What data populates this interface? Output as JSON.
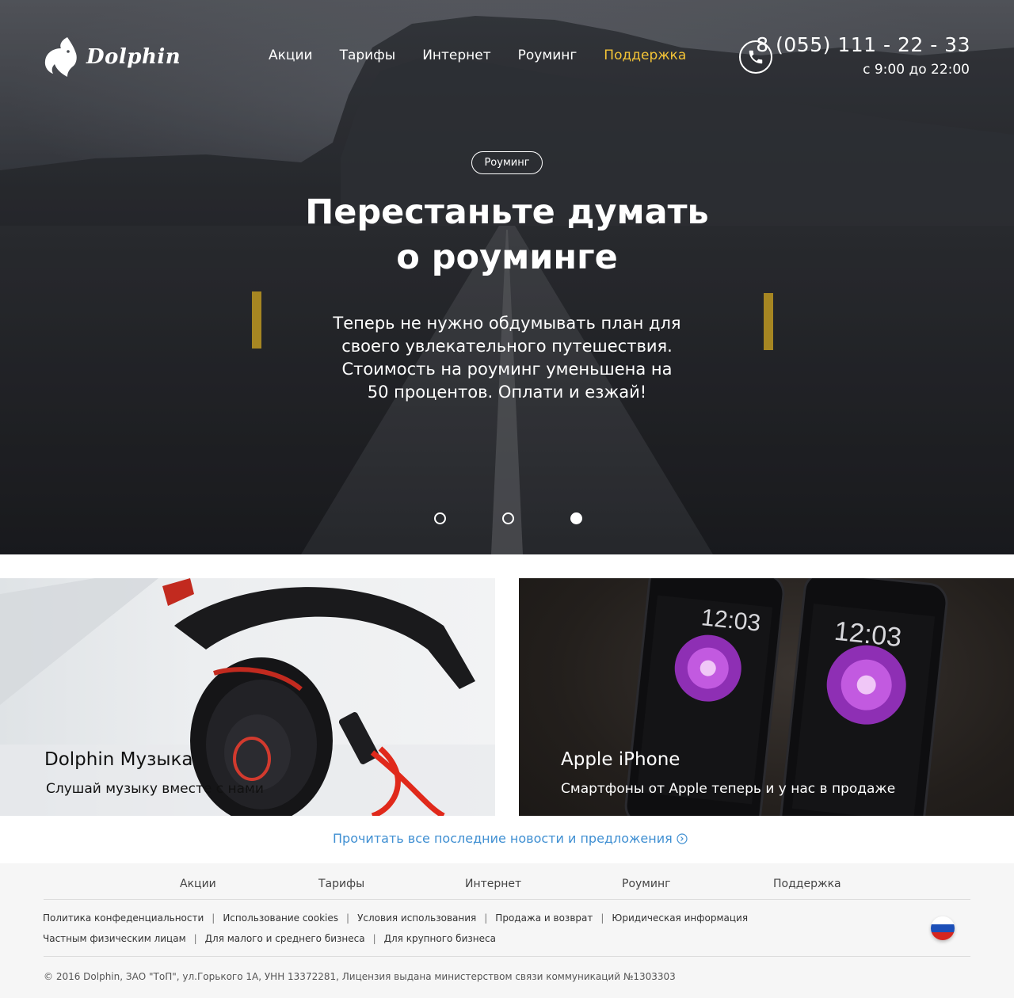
{
  "header": {
    "logo_text": "Dolphin",
    "nav": [
      {
        "label": "Акции"
      },
      {
        "label": "Тарифы"
      },
      {
        "label": "Интернет"
      },
      {
        "label": "Роуминг"
      },
      {
        "label": "Поддержка",
        "active": true
      }
    ],
    "phone_number": "8 (055) 111 - 22 - 33",
    "phone_hours": "с 9:00 до 22:00"
  },
  "hero": {
    "badge": "Роуминг",
    "title_line1": "Перестаньте думать",
    "title_line2": "о роуминге",
    "text_line1": "Теперь не нужно обдумывать план для",
    "text_line2": "своего увлекательного путешествия.",
    "text_line3": "Стоимость на роуминг уменьшена на",
    "text_line4": "50 процентов. Оплати и езжай!",
    "slides_count": 3,
    "active_slide": 3
  },
  "cards": [
    {
      "title": "Dolphin Музыка",
      "subtitle": "Слушай музыку вместе с нами"
    },
    {
      "title": "Apple iPhone",
      "subtitle": "Смартфоны от Apple теперь и у нас в продаже",
      "phone_time": "12:03"
    }
  ],
  "news_link": "Прочитать все последние новости и предложения",
  "footer": {
    "nav": [
      "Акции",
      "Тарифы",
      "Интернет",
      "Роуминг",
      "Поддержка"
    ],
    "legal_row1": [
      "Политика конфеденциальности",
      "Использование cookies",
      "Условия использования",
      "Продажа и возврат",
      "Юридическая информация"
    ],
    "legal_row2": [
      "Частным физическим лицам",
      "Для малого и среднего бизнеса",
      "Для крупного бизнеса"
    ],
    "separator": "|",
    "copyright": "© 2016 Dolphin, ЗАО \"ТоП\", ул.Горького 1А, УНН 13372281, Лицензия выдана министерством связи коммуникаций №1303303"
  },
  "colors": {
    "accent_nav": "#f4c436",
    "link": "#3f8fd2",
    "footer_bg": "#f6f6f6"
  },
  "icons": {
    "logo": "dolphin-icon",
    "phone": "phone-icon",
    "news_arrow": "circle-arrow-right-icon",
    "flag": "russia-flag-icon"
  }
}
